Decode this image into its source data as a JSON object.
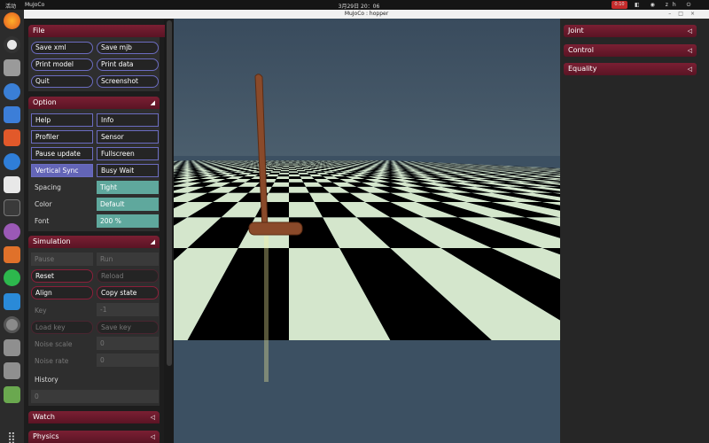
{
  "topbar": {
    "activities": "活动",
    "app": "MuJoCo",
    "clock": "3月29日 20：06",
    "recording": "0:10",
    "tray": "zh"
  },
  "window": {
    "title": "MuJoCo : hopper"
  },
  "file": {
    "header": "File",
    "buttons": [
      "Save xml",
      "Save mjb",
      "Print model",
      "Print data",
      "Quit",
      "Screenshot"
    ]
  },
  "option": {
    "header": "Option",
    "toggles": [
      "Help",
      "Info",
      "Profiler",
      "Sensor",
      "Pause update",
      "Fullscreen",
      "Vertical Sync",
      "Busy Wait"
    ],
    "spacing_label": "Spacing",
    "spacing_value": "Tight",
    "color_label": "Color",
    "color_value": "Default",
    "font_label": "Font",
    "font_value": "200 %"
  },
  "simulation": {
    "header": "Simulation",
    "pause": "Pause",
    "run": "Run",
    "reset": "Reset",
    "reload": "Reload",
    "align": "Align",
    "copy_state": "Copy state",
    "key_label": "Key",
    "key_value": "-1",
    "load_key": "Load key",
    "save_key": "Save key",
    "noise_scale_label": "Noise scale",
    "noise_scale_value": "0",
    "noise_rate_label": "Noise rate",
    "noise_rate_value": "0",
    "history_label": "History",
    "history_value": "0"
  },
  "watch": {
    "header": "Watch"
  },
  "physics": {
    "header": "Physics"
  },
  "right": {
    "joint": "Joint",
    "control": "Control",
    "equality": "Equality"
  },
  "colors": {
    "accent": "#6b1a2d",
    "toggle_border": "#6b6cc0",
    "value_fill": "#5fa89d",
    "floor_light": "#d4e6cc",
    "floor_dark": "#000000"
  },
  "icons": {
    "expand": "◢",
    "collapse": "◁"
  }
}
